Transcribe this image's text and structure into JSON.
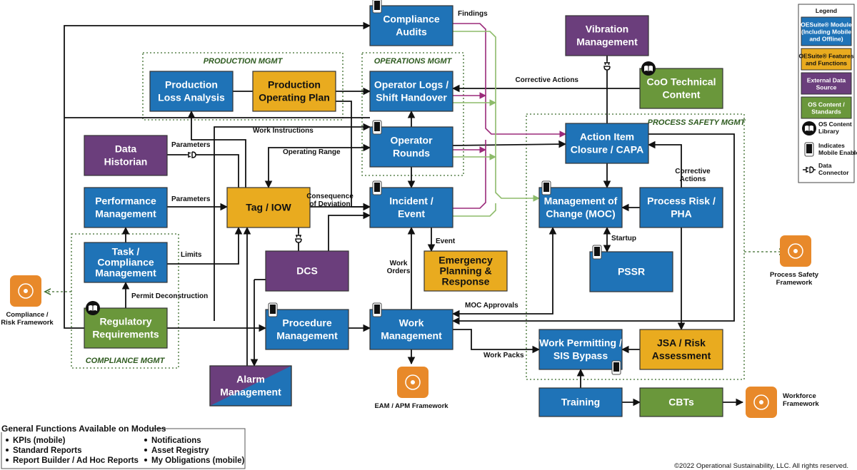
{
  "colors": {
    "module": "#1f73b7",
    "feature": "#e9ab1f",
    "external": "#6b3e7c",
    "content": "#6a973b",
    "framework": "#e8892a",
    "line": "#111111",
    "findings_line": "#9b2a7a",
    "content_line": "#8dbb6a",
    "group_border": "#3a6b2a"
  },
  "groups": [
    {
      "id": "production",
      "label": "PRODUCTION MGMT"
    },
    {
      "id": "operations",
      "label": "OPERATIONS MGMT"
    },
    {
      "id": "process_safety",
      "label": "PROCESS SAFETY MGMT"
    },
    {
      "id": "compliance",
      "label": "COMPLIANCE MGMT"
    }
  ],
  "nodes": [
    {
      "id": "compliance_audits",
      "lines": [
        "Compliance",
        "Audits"
      ],
      "type": "module",
      "mobile": true
    },
    {
      "id": "production_loss",
      "lines": [
        "Production",
        "Loss Analysis"
      ],
      "type": "module"
    },
    {
      "id": "production_plan",
      "lines": [
        "Production",
        "Operating Plan"
      ],
      "type": "feature"
    },
    {
      "id": "operator_logs",
      "lines": [
        "Operator Logs /",
        "Shift Handover"
      ],
      "type": "module"
    },
    {
      "id": "operator_rounds",
      "lines": [
        "Operator",
        "Rounds"
      ],
      "type": "module",
      "mobile": true
    },
    {
      "id": "vibration",
      "lines": [
        "Vibration",
        "Management"
      ],
      "type": "external"
    },
    {
      "id": "coo_content",
      "lines": [
        "CoO Technical",
        "Content"
      ],
      "type": "content",
      "library": true
    },
    {
      "id": "data_historian",
      "lines": [
        "Data",
        "Historian"
      ],
      "type": "external"
    },
    {
      "id": "performance",
      "lines": [
        "Performance",
        "Management"
      ],
      "type": "module"
    },
    {
      "id": "tag_iow",
      "lines": [
        "Tag / IOW"
      ],
      "type": "feature"
    },
    {
      "id": "incident",
      "lines": [
        "Incident /",
        "Event"
      ],
      "type": "module",
      "mobile": true
    },
    {
      "id": "action_item",
      "lines": [
        "Action Item",
        "Closure / CAPA"
      ],
      "type": "module"
    },
    {
      "id": "moc",
      "lines": [
        "Management of",
        "Change (MOC)"
      ],
      "type": "module",
      "mobile": true
    },
    {
      "id": "process_risk",
      "lines": [
        "Process Risk /",
        "PHA"
      ],
      "type": "module"
    },
    {
      "id": "pssr",
      "lines": [
        "PSSR"
      ],
      "type": "module",
      "mobile": true
    },
    {
      "id": "task_compliance",
      "lines": [
        "Task /",
        "Compliance",
        "Management"
      ],
      "type": "module"
    },
    {
      "id": "dcs",
      "lines": [
        "DCS"
      ],
      "type": "external"
    },
    {
      "id": "emergency",
      "lines": [
        "Emergency",
        "Planning &",
        "Response"
      ],
      "type": "feature"
    },
    {
      "id": "regulatory",
      "lines": [
        "Regulatory",
        "Requirements"
      ],
      "type": "content",
      "library": true
    },
    {
      "id": "procedure",
      "lines": [
        "Procedure",
        "Management"
      ],
      "type": "module",
      "mobile": true
    },
    {
      "id": "work_mgmt",
      "lines": [
        "Work",
        "Management"
      ],
      "type": "module",
      "mobile": true
    },
    {
      "id": "work_permitting",
      "lines": [
        "Work Permitting /",
        "SIS Bypass"
      ],
      "type": "module",
      "mobile": true
    },
    {
      "id": "jsa",
      "lines": [
        "JSA / Risk",
        "Assessment"
      ],
      "type": "feature"
    },
    {
      "id": "alarm",
      "lines": [
        "Alarm",
        "Management"
      ],
      "type": "split"
    },
    {
      "id": "training",
      "lines": [
        "Training"
      ],
      "type": "module"
    },
    {
      "id": "cbts",
      "lines": [
        "CBTs"
      ],
      "type": "content"
    }
  ],
  "edge_labels": {
    "findings": "Findings",
    "corrective_actions": "Corrective Actions",
    "work_instructions": "Work Instructions",
    "parameters_historian": "Parameters",
    "operating_range": "Operating Range",
    "parameters_perf": "Parameters",
    "consequence": [
      "Consequence",
      "of Deviation"
    ],
    "corrective_actions_pha": [
      "Corrective",
      "Actions"
    ],
    "startup": "Startup",
    "limits": "Limits",
    "permit_deconstruction": "Permit Deconstruction",
    "event": "Event",
    "work_orders": [
      "Work",
      "Orders"
    ],
    "moc_approvals": "MOC Approvals",
    "work_packs": "Work Packs"
  },
  "frameworks": [
    {
      "id": "compliance_risk",
      "lines": [
        "Compliance /",
        "Risk Framework"
      ]
    },
    {
      "id": "process_safety",
      "lines": [
        "Process Safety",
        "Framework"
      ]
    },
    {
      "id": "eam_apm",
      "lines": [
        "EAM / APM Framework"
      ]
    },
    {
      "id": "workforce",
      "lines": [
        "Workforce",
        "Framework"
      ]
    }
  ],
  "legend": {
    "title": "Legend",
    "items": [
      {
        "type": "module",
        "lines": [
          "OESuite® Module",
          "(Including Mobile",
          "and Offline)"
        ]
      },
      {
        "type": "feature",
        "lines": [
          "OESuite® Features",
          "and Functions"
        ]
      },
      {
        "type": "external",
        "lines": [
          "External Data",
          "Source"
        ]
      },
      {
        "type": "content",
        "lines": [
          "OS Content /",
          "Standards"
        ]
      }
    ],
    "icons": [
      {
        "icon": "book-icon",
        "lines": [
          "OS Content",
          "Library"
        ]
      },
      {
        "icon": "mobile-phone-icon",
        "lines": [
          "Indicates",
          "Mobile Enabled"
        ]
      },
      {
        "icon": "data-connector-icon",
        "lines": [
          "Data",
          "Connector"
        ]
      }
    ]
  },
  "general_functions": {
    "title": "General Functions Available on Modules",
    "left": [
      "KPIs (mobile)",
      "Standard Reports",
      "Report Builder / Ad Hoc Reports"
    ],
    "right": [
      "Notifications",
      "Asset Registry",
      "My Obligations (mobile)"
    ]
  },
  "copyright": "©2022 Operational Sustainability, LLC. All rights reserved."
}
